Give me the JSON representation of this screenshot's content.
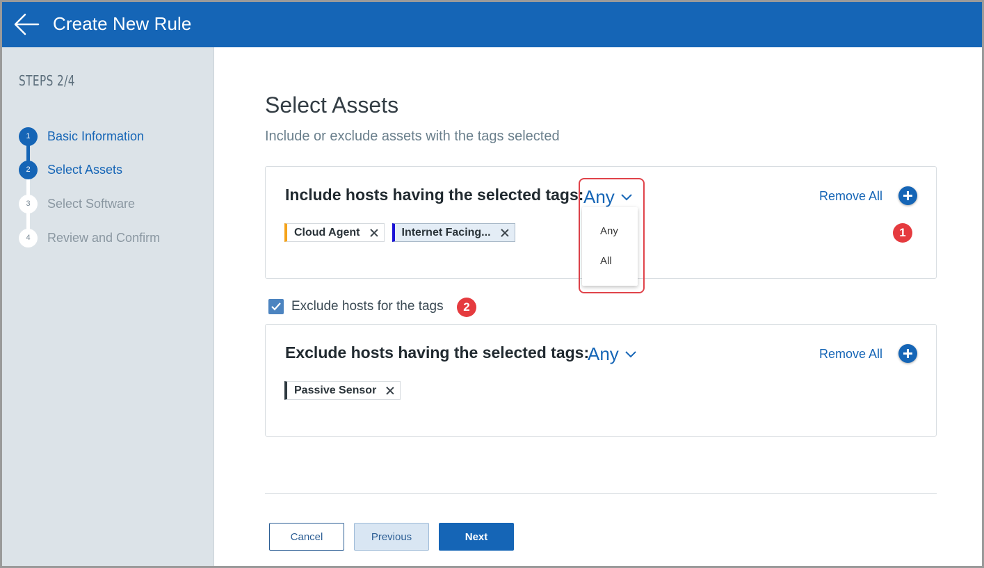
{
  "header": {
    "title": "Create New Rule",
    "back_icon": "arrow-left-icon",
    "color": "#1565b6"
  },
  "sidebar": {
    "steps_label": "STEPS 2/4",
    "steps": [
      {
        "number": "1",
        "label": "Basic Information",
        "state": "complete"
      },
      {
        "number": "2",
        "label": "Select Assets",
        "state": "current"
      },
      {
        "number": "3",
        "label": "Select Software",
        "state": "upcoming"
      },
      {
        "number": "4",
        "label": "Review and Confirm",
        "state": "upcoming"
      }
    ]
  },
  "main": {
    "title": "Select Assets",
    "subtitle": "Include or exclude assets with the tags selected",
    "include": {
      "heading": "Include hosts having the selected tags:",
      "match_value": "Any",
      "remove_all": "Remove All",
      "tags": [
        {
          "label": "Cloud Agent",
          "color": "#f5a31a"
        },
        {
          "label": "Internet Facing...",
          "color": "#1a12d6"
        }
      ],
      "dropdown_options": [
        "Any",
        "All"
      ]
    },
    "exclude_toggle": {
      "label": "Exclude hosts for the tags",
      "checked": true
    },
    "exclude": {
      "heading": "Exclude hosts having the selected tags:",
      "match_value": "Any",
      "remove_all": "Remove All",
      "tags": [
        {
          "label": "Passive Sensor",
          "color": "#2e3940"
        }
      ]
    },
    "callouts": [
      "1",
      "2"
    ]
  },
  "footer": {
    "cancel": "Cancel",
    "previous": "Previous",
    "next": "Next"
  }
}
